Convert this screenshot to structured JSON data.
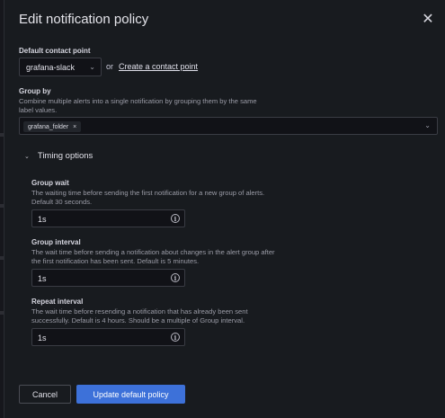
{
  "modal": {
    "title": "Edit notification policy",
    "close_symbol": "✕"
  },
  "contact_point": {
    "label": "Default contact point",
    "selected": "grafana-slack",
    "or_text": "or",
    "create_link": "Create a contact point"
  },
  "group_by": {
    "label": "Group by",
    "description_line1": "Combine multiple alerts into a single notification by grouping them by the same",
    "description_line2": "label values.",
    "tags": [
      {
        "label": "grafana_folder",
        "remove": "×"
      }
    ]
  },
  "timing": {
    "toggle_label": "Timing options",
    "group_wait": {
      "label": "Group wait",
      "description_line1": "The waiting time before sending the first notification for a new group of alerts.",
      "description_line2": "Default 30 seconds.",
      "value": "1s"
    },
    "group_interval": {
      "label": "Group interval",
      "description_line1": "The wait time before sending a notification about changes in the alert group after",
      "description_line2": "the first notification has been sent. Default is 5 minutes.",
      "value": "1s"
    },
    "repeat_interval": {
      "label": "Repeat interval",
      "description_line1": "The wait time before resending a notification that has already been sent",
      "description_line2": "successfully. Default is 4 hours. Should be a multiple of Group interval.",
      "value": "1s"
    }
  },
  "actions": {
    "cancel_label": "Cancel",
    "submit_label": "Update default policy"
  },
  "icons": {
    "info": "info-circle-icon",
    "chevron": "chevron-down-icon",
    "close": "close-icon"
  },
  "colors": {
    "primary": "#3d71d9",
    "background": "#181b1f"
  }
}
